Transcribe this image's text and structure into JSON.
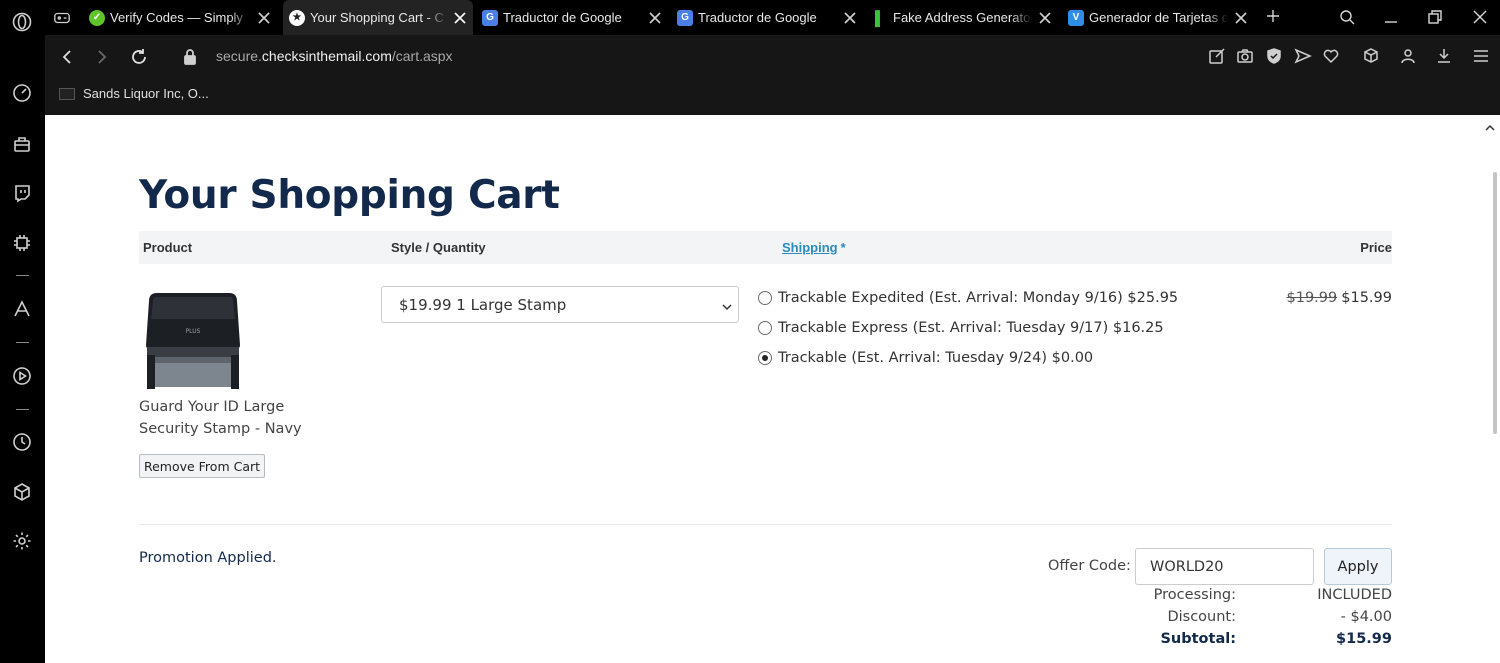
{
  "browser": {
    "tabs": [
      {
        "title": "Verify Codes — Simply",
        "favicon": "check-circle-icon",
        "fav_color": "#5fc52a",
        "active": false
      },
      {
        "title": "Your Shopping Cart - C",
        "favicon": "star-badge-icon",
        "fav_color": "#ffffff",
        "active": true
      },
      {
        "title": "Traductor de Google",
        "favicon": "google-translate-icon",
        "fav_color": "#4a7fe6",
        "active": false
      },
      {
        "title": "Traductor de Google",
        "favicon": "google-translate-icon",
        "fav_color": "#4a7fe6",
        "active": false
      },
      {
        "title": "Fake Address Generator",
        "favicon": "green-bars-icon",
        "fav_color": "#3bc43b",
        "active": false
      },
      {
        "title": "Generador de Tarjetas d",
        "favicon": "v-icon",
        "fav_color": "#2e8de6",
        "active": false
      }
    ],
    "url_prefix": "secure.",
    "url_domain": "checksinthemail.com",
    "url_path": "/cart.aspx",
    "bookmark": "Sands Liquor Inc, O..."
  },
  "page": {
    "title": "Your Shopping Cart",
    "columns": {
      "product": "Product",
      "style_quantity": "Style / Quantity",
      "shipping": "Shipping",
      "shipping_marker": "*",
      "price": "Price"
    },
    "item": {
      "name": "Guard Your ID Large Security Stamp - Navy",
      "remove_label": "Remove From Cart",
      "style_selected": "$19.99 1 Large Stamp",
      "original_price": "$19.99",
      "price": "$15.99"
    },
    "shipping_options": [
      {
        "label": "Trackable Expedited (Est. Arrival: Monday 9/16) $25.95",
        "selected": false
      },
      {
        "label": "Trackable Express (Est. Arrival: Tuesday 9/17) $16.25",
        "selected": false
      },
      {
        "label": "Trackable (Est. Arrival: Tuesday 9/24) $0.00",
        "selected": true
      }
    ],
    "promo_text": "Promotion Applied.",
    "offer": {
      "label": "Offer Code:",
      "value": "WORLD20",
      "apply_label": "Apply"
    },
    "summary": {
      "processing_label": "Processing:",
      "processing_value": "INCLUDED",
      "discount_label": "Discount:",
      "discount_value": "- $4.00",
      "subtotal_label": "Subtotal:",
      "subtotal_value": "$15.99"
    }
  }
}
